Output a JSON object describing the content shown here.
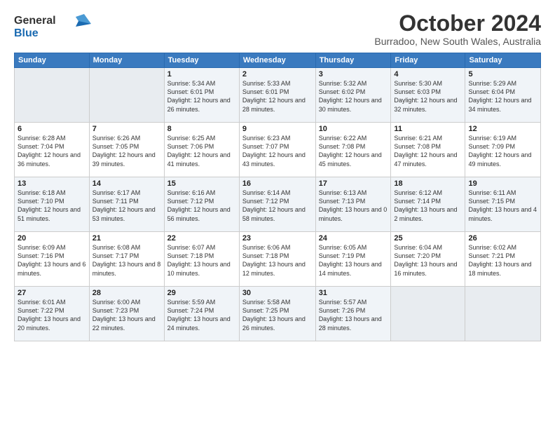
{
  "logo": {
    "line1": "General",
    "line2": "Blue"
  },
  "title": "October 2024",
  "subtitle": "Burradoo, New South Wales, Australia",
  "days_of_week": [
    "Sunday",
    "Monday",
    "Tuesday",
    "Wednesday",
    "Thursday",
    "Friday",
    "Saturday"
  ],
  "weeks": [
    [
      {
        "day": "",
        "info": ""
      },
      {
        "day": "",
        "info": ""
      },
      {
        "day": "1",
        "info": "Sunrise: 5:34 AM\nSunset: 6:01 PM\nDaylight: 12 hours\nand 26 minutes."
      },
      {
        "day": "2",
        "info": "Sunrise: 5:33 AM\nSunset: 6:01 PM\nDaylight: 12 hours\nand 28 minutes."
      },
      {
        "day": "3",
        "info": "Sunrise: 5:32 AM\nSunset: 6:02 PM\nDaylight: 12 hours\nand 30 minutes."
      },
      {
        "day": "4",
        "info": "Sunrise: 5:30 AM\nSunset: 6:03 PM\nDaylight: 12 hours\nand 32 minutes."
      },
      {
        "day": "5",
        "info": "Sunrise: 5:29 AM\nSunset: 6:04 PM\nDaylight: 12 hours\nand 34 minutes."
      }
    ],
    [
      {
        "day": "6",
        "info": "Sunrise: 6:28 AM\nSunset: 7:04 PM\nDaylight: 12 hours\nand 36 minutes."
      },
      {
        "day": "7",
        "info": "Sunrise: 6:26 AM\nSunset: 7:05 PM\nDaylight: 12 hours\nand 39 minutes."
      },
      {
        "day": "8",
        "info": "Sunrise: 6:25 AM\nSunset: 7:06 PM\nDaylight: 12 hours\nand 41 minutes."
      },
      {
        "day": "9",
        "info": "Sunrise: 6:23 AM\nSunset: 7:07 PM\nDaylight: 12 hours\nand 43 minutes."
      },
      {
        "day": "10",
        "info": "Sunrise: 6:22 AM\nSunset: 7:08 PM\nDaylight: 12 hours\nand 45 minutes."
      },
      {
        "day": "11",
        "info": "Sunrise: 6:21 AM\nSunset: 7:08 PM\nDaylight: 12 hours\nand 47 minutes."
      },
      {
        "day": "12",
        "info": "Sunrise: 6:19 AM\nSunset: 7:09 PM\nDaylight: 12 hours\nand 49 minutes."
      }
    ],
    [
      {
        "day": "13",
        "info": "Sunrise: 6:18 AM\nSunset: 7:10 PM\nDaylight: 12 hours\nand 51 minutes."
      },
      {
        "day": "14",
        "info": "Sunrise: 6:17 AM\nSunset: 7:11 PM\nDaylight: 12 hours\nand 53 minutes."
      },
      {
        "day": "15",
        "info": "Sunrise: 6:16 AM\nSunset: 7:12 PM\nDaylight: 12 hours\nand 56 minutes."
      },
      {
        "day": "16",
        "info": "Sunrise: 6:14 AM\nSunset: 7:12 PM\nDaylight: 12 hours\nand 58 minutes."
      },
      {
        "day": "17",
        "info": "Sunrise: 6:13 AM\nSunset: 7:13 PM\nDaylight: 13 hours\nand 0 minutes."
      },
      {
        "day": "18",
        "info": "Sunrise: 6:12 AM\nSunset: 7:14 PM\nDaylight: 13 hours\nand 2 minutes."
      },
      {
        "day": "19",
        "info": "Sunrise: 6:11 AM\nSunset: 7:15 PM\nDaylight: 13 hours\nand 4 minutes."
      }
    ],
    [
      {
        "day": "20",
        "info": "Sunrise: 6:09 AM\nSunset: 7:16 PM\nDaylight: 13 hours\nand 6 minutes."
      },
      {
        "day": "21",
        "info": "Sunrise: 6:08 AM\nSunset: 7:17 PM\nDaylight: 13 hours\nand 8 minutes."
      },
      {
        "day": "22",
        "info": "Sunrise: 6:07 AM\nSunset: 7:18 PM\nDaylight: 13 hours\nand 10 minutes."
      },
      {
        "day": "23",
        "info": "Sunrise: 6:06 AM\nSunset: 7:18 PM\nDaylight: 13 hours\nand 12 minutes."
      },
      {
        "day": "24",
        "info": "Sunrise: 6:05 AM\nSunset: 7:19 PM\nDaylight: 13 hours\nand 14 minutes."
      },
      {
        "day": "25",
        "info": "Sunrise: 6:04 AM\nSunset: 7:20 PM\nDaylight: 13 hours\nand 16 minutes."
      },
      {
        "day": "26",
        "info": "Sunrise: 6:02 AM\nSunset: 7:21 PM\nDaylight: 13 hours\nand 18 minutes."
      }
    ],
    [
      {
        "day": "27",
        "info": "Sunrise: 6:01 AM\nSunset: 7:22 PM\nDaylight: 13 hours\nand 20 minutes."
      },
      {
        "day": "28",
        "info": "Sunrise: 6:00 AM\nSunset: 7:23 PM\nDaylight: 13 hours\nand 22 minutes."
      },
      {
        "day": "29",
        "info": "Sunrise: 5:59 AM\nSunset: 7:24 PM\nDaylight: 13 hours\nand 24 minutes."
      },
      {
        "day": "30",
        "info": "Sunrise: 5:58 AM\nSunset: 7:25 PM\nDaylight: 13 hours\nand 26 minutes."
      },
      {
        "day": "31",
        "info": "Sunrise: 5:57 AM\nSunset: 7:26 PM\nDaylight: 13 hours\nand 28 minutes."
      },
      {
        "day": "",
        "info": ""
      },
      {
        "day": "",
        "info": ""
      }
    ]
  ]
}
